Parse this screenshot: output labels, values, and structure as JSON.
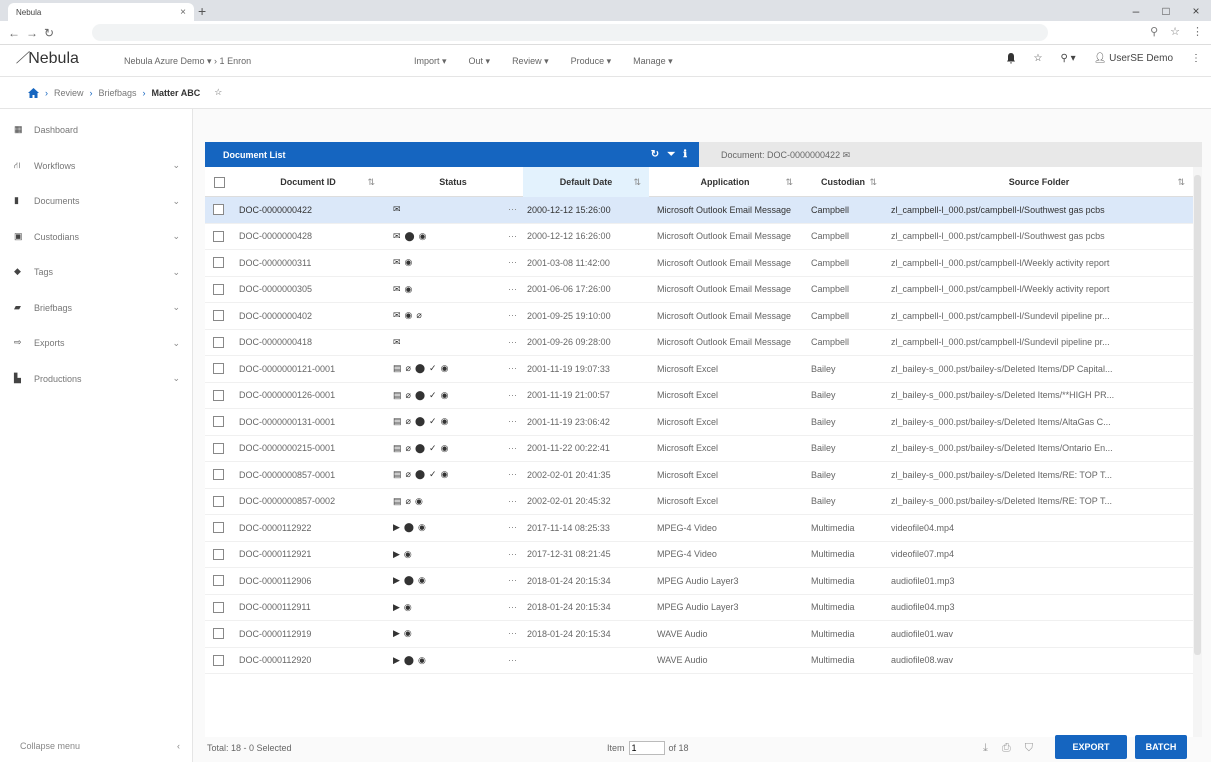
{
  "browser": {
    "tab_title": "Nebula",
    "tab_close": "×",
    "new_tab": "+",
    "win_min": "–",
    "win_max": "□",
    "win_close": "×"
  },
  "app": {
    "logo": "Nebula",
    "project": "Nebula Azure Demo ▾  ›  1 Enron",
    "menus": [
      "Import ▾",
      "Out ▾",
      "Review ▾",
      "Produce ▾",
      "Manage ▾"
    ],
    "user": "UserSE Demo"
  },
  "breadcrumb": [
    "Review",
    "Briefbags",
    "Matter ABC"
  ],
  "sidebar": {
    "items": [
      {
        "label": "Dashboard",
        "icon": "dashboard-icon",
        "chevron": false
      },
      {
        "label": "Workflows",
        "icon": "workflow-icon",
        "chevron": true
      },
      {
        "label": "Documents",
        "icon": "document-icon",
        "chevron": true
      },
      {
        "label": "Custodians",
        "icon": "custodian-icon",
        "chevron": true
      },
      {
        "label": "Tags",
        "icon": "tag-icon",
        "chevron": true
      },
      {
        "label": "Briefbags",
        "icon": "briefcase-icon",
        "chevron": true
      },
      {
        "label": "Exports",
        "icon": "export-icon",
        "chevron": true
      },
      {
        "label": "Productions",
        "icon": "production-icon",
        "chevron": true
      }
    ],
    "collapse_label": "Collapse menu"
  },
  "panel": {
    "tab_label": "Document List",
    "document_label": "Document: DOC-0000000422"
  },
  "table": {
    "columns": [
      "Document ID",
      "Status",
      "Default Date",
      "Application",
      "Custodian",
      "Source Folder"
    ],
    "rows": [
      {
        "id": "DOC-0000000422",
        "status": [
          "email-icon"
        ],
        "date": "2000-12-12 15:26:00",
        "app": "Microsoft Outlook Email Message",
        "cust": "Campbell",
        "src": "zl_campbell-l_000.pst/campbell-l/Southwest gas pcbs"
      },
      {
        "id": "DOC-0000000428",
        "status": [
          "email-icon",
          "tag-icon",
          "eye-icon"
        ],
        "date": "2000-12-12 16:26:00",
        "app": "Microsoft Outlook Email Message",
        "cust": "Campbell",
        "src": "zl_campbell-l_000.pst/campbell-l/Southwest gas pcbs"
      },
      {
        "id": "DOC-0000000311",
        "status": [
          "email-icon",
          "eye-icon"
        ],
        "date": "2001-03-08 11:42:00",
        "app": "Microsoft Outlook Email Message",
        "cust": "Campbell",
        "src": "zl_campbell-l_000.pst/campbell-l/Weekly activity report"
      },
      {
        "id": "DOC-0000000305",
        "status": [
          "email-icon",
          "eye-icon"
        ],
        "date": "2001-06-06 17:26:00",
        "app": "Microsoft Outlook Email Message",
        "cust": "Campbell",
        "src": "zl_campbell-l_000.pst/campbell-l/Weekly activity report"
      },
      {
        "id": "DOC-0000000402",
        "status": [
          "email-icon",
          "eye-icon",
          "attachment-icon"
        ],
        "date": "2001-09-25 19:10:00",
        "app": "Microsoft Outlook Email Message",
        "cust": "Campbell",
        "src": "zl_campbell-l_000.pst/campbell-l/Sundevil pipeline pr..."
      },
      {
        "id": "DOC-0000000418",
        "status": [
          "email-icon"
        ],
        "date": "2001-09-26 09:28:00",
        "app": "Microsoft Outlook Email Message",
        "cust": "Campbell",
        "src": "zl_campbell-l_000.pst/campbell-l/Sundevil pipeline pr..."
      },
      {
        "id": "DOC-0000000121-0001",
        "status": [
          "file-icon",
          "attachment-icon",
          "tag-icon",
          "check-icon",
          "eye-icon"
        ],
        "date": "2001-11-19 19:07:33",
        "app": "Microsoft Excel",
        "cust": "Bailey",
        "src": "zl_bailey-s_000.pst/bailey-s/Deleted Items/DP Capital..."
      },
      {
        "id": "DOC-0000000126-0001",
        "status": [
          "file-icon",
          "attachment-icon",
          "tag-icon",
          "check-icon",
          "eye-icon"
        ],
        "date": "2001-11-19 21:00:57",
        "app": "Microsoft Excel",
        "cust": "Bailey",
        "src": "zl_bailey-s_000.pst/bailey-s/Deleted Items/**HIGH PR..."
      },
      {
        "id": "DOC-0000000131-0001",
        "status": [
          "file-icon",
          "attachment-icon",
          "tag-icon",
          "check-icon",
          "eye-icon"
        ],
        "date": "2001-11-19 23:06:42",
        "app": "Microsoft Excel",
        "cust": "Bailey",
        "src": "zl_bailey-s_000.pst/bailey-s/Deleted Items/AltaGas C..."
      },
      {
        "id": "DOC-0000000215-0001",
        "status": [
          "file-icon",
          "attachment-icon",
          "tag-icon",
          "check-icon",
          "eye-icon"
        ],
        "date": "2001-11-22 00:22:41",
        "app": "Microsoft Excel",
        "cust": "Bailey",
        "src": "zl_bailey-s_000.pst/bailey-s/Deleted Items/Ontario En..."
      },
      {
        "id": "DOC-0000000857-0001",
        "status": [
          "file-icon",
          "attachment-icon",
          "tag-icon",
          "check-icon",
          "eye-icon"
        ],
        "date": "2002-02-01 20:41:35",
        "app": "Microsoft Excel",
        "cust": "Bailey",
        "src": "zl_bailey-s_000.pst/bailey-s/Deleted Items/RE: TOP T..."
      },
      {
        "id": "DOC-0000000857-0002",
        "status": [
          "file-icon",
          "attachment-icon",
          "eye-icon"
        ],
        "date": "2002-02-01 20:45:32",
        "app": "Microsoft Excel",
        "cust": "Bailey",
        "src": "zl_bailey-s_000.pst/bailey-s/Deleted Items/RE: TOP T..."
      },
      {
        "id": "DOC-0000112922",
        "status": [
          "media-icon",
          "tag-icon",
          "eye-icon"
        ],
        "date": "2017-11-14 08:25:33",
        "app": "MPEG-4 Video",
        "cust": "Multimedia",
        "src": "videofile04.mp4"
      },
      {
        "id": "DOC-0000112921",
        "status": [
          "media-icon",
          "eye-icon"
        ],
        "date": "2017-12-31 08:21:45",
        "app": "MPEG-4 Video",
        "cust": "Multimedia",
        "src": "videofile07.mp4"
      },
      {
        "id": "DOC-0000112906",
        "status": [
          "media-icon",
          "tag-icon",
          "eye-icon"
        ],
        "date": "2018-01-24 20:15:34",
        "app": "MPEG Audio Layer3",
        "cust": "Multimedia",
        "src": "audiofile01.mp3"
      },
      {
        "id": "DOC-0000112911",
        "status": [
          "media-icon",
          "eye-icon"
        ],
        "date": "2018-01-24 20:15:34",
        "app": "MPEG Audio Layer3",
        "cust": "Multimedia",
        "src": "audiofile04.mp3"
      },
      {
        "id": "DOC-0000112919",
        "status": [
          "media-icon",
          "eye-icon"
        ],
        "date": "2018-01-24 20:15:34",
        "app": "WAVE Audio",
        "cust": "Multimedia",
        "src": "audiofile01.wav"
      },
      {
        "id": "DOC-0000112920",
        "status": [
          "media-icon",
          "tag-icon",
          "eye-icon"
        ],
        "date": "",
        "app": "WAVE Audio",
        "cust": "Multimedia",
        "src": "audiofile08.wav"
      }
    ]
  },
  "footer": {
    "total": "Total: 18 - 0 Selected",
    "item_label": "Item",
    "item_value": "1",
    "of_label": "of 18",
    "export": "EXPORT",
    "batch": "BATCH"
  },
  "colors": {
    "accent": "#1565c0",
    "selected_row": "#dbe8f9"
  }
}
